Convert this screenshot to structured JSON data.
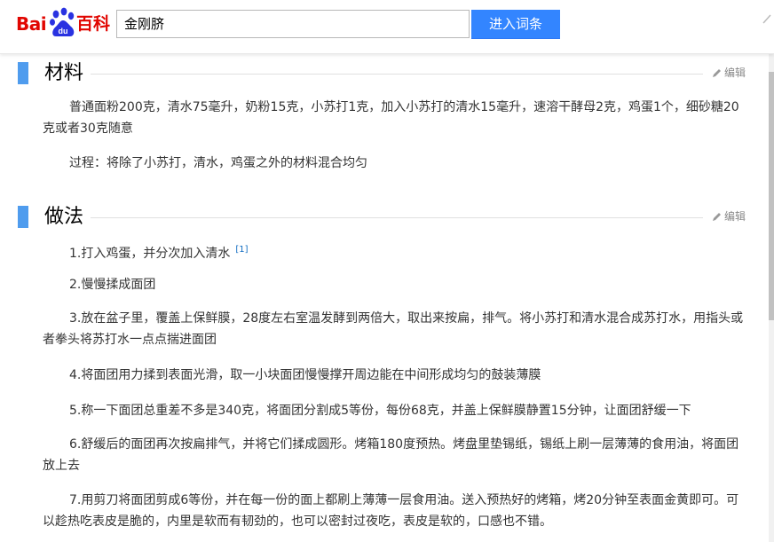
{
  "header": {
    "logo_bai": "Bai",
    "logo_du": "du",
    "logo_baike": "百科",
    "search_value": "金刚脐",
    "search_button": "进入词条"
  },
  "colors": {
    "accent": "#3385ff",
    "brand_red": "#e10601",
    "section_bar": "#4f9cee"
  },
  "sections": [
    {
      "title": "材料",
      "edit_label": "编辑",
      "paragraphs": [
        "普通面粉200克，清水75毫升，奶粉15克，小苏打1克，加入小苏打的清水15毫升，速溶干酵母2克，鸡蛋1个，细砂糖20克或者30克随意",
        "过程：将除了小苏打，清水，鸡蛋之外的材料混合均匀"
      ]
    },
    {
      "title": "做法",
      "edit_label": "编辑",
      "steps": [
        {
          "text": "1.打入鸡蛋，并分次加入清水",
          "ref": "[1]"
        },
        {
          "text": "2.慢慢揉成面团"
        },
        {
          "text": "3.放在盆子里，覆盖上保鲜膜，28度左右室温发酵到两倍大，取出来按扁，排气。将小苏打和清水混合成苏打水，用指头或者拳头将苏打水一点点揣进面团"
        },
        {
          "text": "4.将面团用力揉到表面光滑，取一小块面团慢慢撑开周边能在中间形成均匀的鼓装薄膜"
        },
        {
          "text": "5.称一下面团总重差不多是340克，将面团分割成5等份，每份68克，并盖上保鲜膜静置15分钟，让面团舒缓一下"
        },
        {
          "text": "6.舒缓后的面团再次按扁排气，并将它们揉成圆形。烤箱180度预热。烤盘里垫锡纸，锡纸上刷一层薄薄的食用油，将面团放上去"
        },
        {
          "text": "7.用剪刀将面团剪成6等份，并在每一份的面上都刷上薄薄一层食用油。送入预热好的烤箱，烤20分钟至表面金黄即可。可以趁热吃表皮是脆的，内里是软而有韧劲的，也可以密封过夜吃，表皮是软的，口感也不错。"
        }
      ]
    }
  ]
}
